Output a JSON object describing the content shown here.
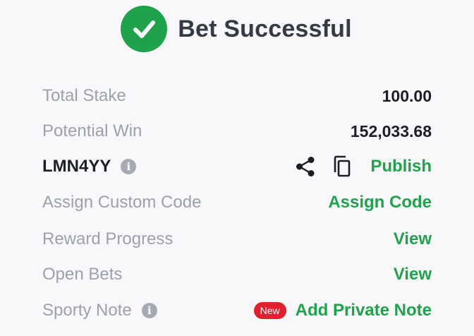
{
  "header": {
    "title": "Bet Successful"
  },
  "summary": {
    "total_stake_label": "Total Stake",
    "total_stake_value": "100.00",
    "potential_win_label": "Potential Win",
    "potential_win_value": "152,033.68"
  },
  "booking": {
    "code": "LMN4YY",
    "publish_label": "Publish"
  },
  "actions": {
    "assign_custom_code_label": "Assign Custom Code",
    "assign_code_link": "Assign Code",
    "reward_progress_label": "Reward Progress",
    "reward_progress_link": "View",
    "open_bets_label": "Open Bets",
    "open_bets_link": "View",
    "sporty_note_label": "Sporty Note",
    "new_badge": "New",
    "add_private_note_link": "Add Private Note"
  },
  "icons": {
    "success": "check-circle-icon",
    "info": "info-icon",
    "share": "share-icon",
    "copy": "copy-icon"
  },
  "colors": {
    "success": "#1fa34a",
    "badge": "#e41f2d"
  }
}
